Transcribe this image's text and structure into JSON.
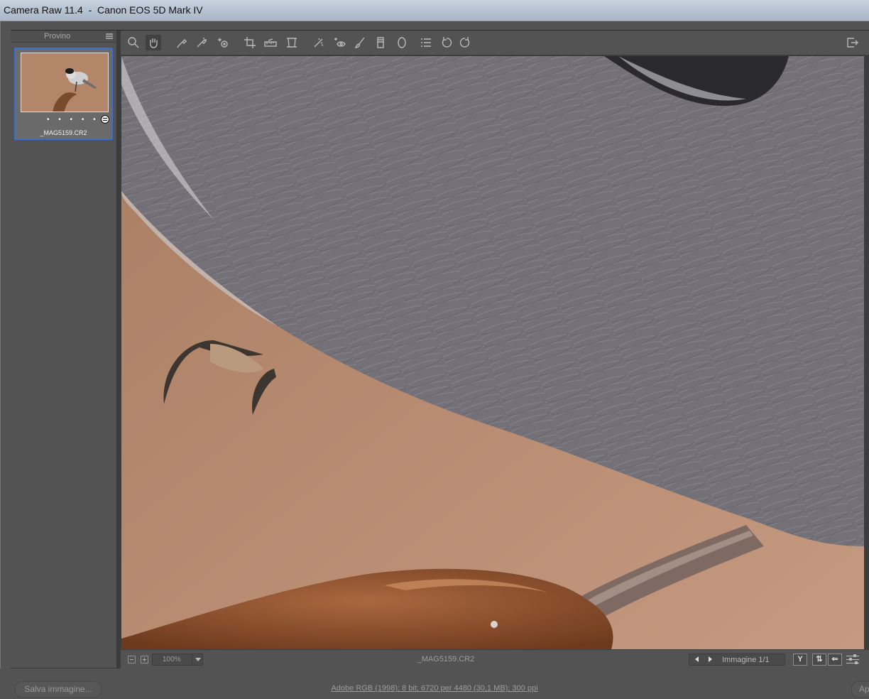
{
  "window": {
    "title": "Camera Raw 11.4  -  Canon EOS 5D Mark IV"
  },
  "filmstrip": {
    "header": "Provino",
    "items": [
      {
        "filename": "_MAG5159.CR2",
        "rating_dots": "• • • • •"
      }
    ]
  },
  "toolbar": {
    "tools": [
      "zoom-icon",
      "hand-icon",
      "white-balance-icon",
      "color-sampler-icon",
      "targeted-adjustment-icon",
      "crop-icon",
      "straighten-icon",
      "transform-icon",
      "spot-removal-icon",
      "red-eye-icon",
      "adjustment-brush-icon",
      "graduated-filter-icon",
      "radial-filter-icon",
      "preferences-icon",
      "rotate-ccw-icon",
      "rotate-cw-icon",
      "toggle-fullscreen-icon"
    ]
  },
  "statusbar": {
    "zoom_value": "100%",
    "filename": "_MAG5159.CR2",
    "image_counter": "Immagine 1/1",
    "view_toggle_label": "Y"
  },
  "bottombar": {
    "save_label": "Salva immagine...",
    "workflow_options": "Adobe RGB (1998); 8 bit; 6720 per 4480 (30,1 MB); 300 ppi",
    "open_label": "Ap"
  }
}
